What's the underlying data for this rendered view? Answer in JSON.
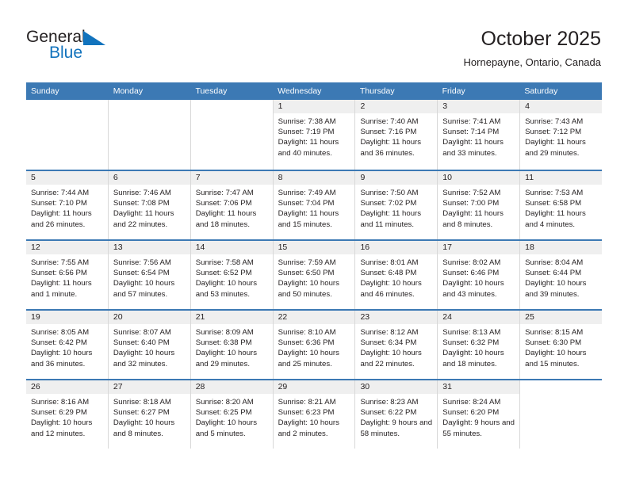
{
  "logo": {
    "word_one": "General",
    "word_two": "Blue",
    "triangle_icon": "triangle-icon",
    "brand_blue": "#1273bd"
  },
  "header": {
    "title": "October 2025",
    "subtitle": "Hornepayne, Ontario, Canada"
  },
  "theme": {
    "header_row_blue": "#3c79b4",
    "daynum_band_gray": "#efefef",
    "text_color": "#231f20"
  },
  "weekdays": [
    "Sunday",
    "Monday",
    "Tuesday",
    "Wednesday",
    "Thursday",
    "Friday",
    "Saturday"
  ],
  "weeks": [
    [
      {
        "day": "",
        "sunrise": "",
        "sunset": "",
        "daylight": ""
      },
      {
        "day": "",
        "sunrise": "",
        "sunset": "",
        "daylight": ""
      },
      {
        "day": "",
        "sunrise": "",
        "sunset": "",
        "daylight": ""
      },
      {
        "day": "1",
        "sunrise": "Sunrise: 7:38 AM",
        "sunset": "Sunset: 7:19 PM",
        "daylight": "Daylight: 11 hours and 40 minutes."
      },
      {
        "day": "2",
        "sunrise": "Sunrise: 7:40 AM",
        "sunset": "Sunset: 7:16 PM",
        "daylight": "Daylight: 11 hours and 36 minutes."
      },
      {
        "day": "3",
        "sunrise": "Sunrise: 7:41 AM",
        "sunset": "Sunset: 7:14 PM",
        "daylight": "Daylight: 11 hours and 33 minutes."
      },
      {
        "day": "4",
        "sunrise": "Sunrise: 7:43 AM",
        "sunset": "Sunset: 7:12 PM",
        "daylight": "Daylight: 11 hours and 29 minutes."
      }
    ],
    [
      {
        "day": "5",
        "sunrise": "Sunrise: 7:44 AM",
        "sunset": "Sunset: 7:10 PM",
        "daylight": "Daylight: 11 hours and 26 minutes."
      },
      {
        "day": "6",
        "sunrise": "Sunrise: 7:46 AM",
        "sunset": "Sunset: 7:08 PM",
        "daylight": "Daylight: 11 hours and 22 minutes."
      },
      {
        "day": "7",
        "sunrise": "Sunrise: 7:47 AM",
        "sunset": "Sunset: 7:06 PM",
        "daylight": "Daylight: 11 hours and 18 minutes."
      },
      {
        "day": "8",
        "sunrise": "Sunrise: 7:49 AM",
        "sunset": "Sunset: 7:04 PM",
        "daylight": "Daylight: 11 hours and 15 minutes."
      },
      {
        "day": "9",
        "sunrise": "Sunrise: 7:50 AM",
        "sunset": "Sunset: 7:02 PM",
        "daylight": "Daylight: 11 hours and 11 minutes."
      },
      {
        "day": "10",
        "sunrise": "Sunrise: 7:52 AM",
        "sunset": "Sunset: 7:00 PM",
        "daylight": "Daylight: 11 hours and 8 minutes."
      },
      {
        "day": "11",
        "sunrise": "Sunrise: 7:53 AM",
        "sunset": "Sunset: 6:58 PM",
        "daylight": "Daylight: 11 hours and 4 minutes."
      }
    ],
    [
      {
        "day": "12",
        "sunrise": "Sunrise: 7:55 AM",
        "sunset": "Sunset: 6:56 PM",
        "daylight": "Daylight: 11 hours and 1 minute."
      },
      {
        "day": "13",
        "sunrise": "Sunrise: 7:56 AM",
        "sunset": "Sunset: 6:54 PM",
        "daylight": "Daylight: 10 hours and 57 minutes."
      },
      {
        "day": "14",
        "sunrise": "Sunrise: 7:58 AM",
        "sunset": "Sunset: 6:52 PM",
        "daylight": "Daylight: 10 hours and 53 minutes."
      },
      {
        "day": "15",
        "sunrise": "Sunrise: 7:59 AM",
        "sunset": "Sunset: 6:50 PM",
        "daylight": "Daylight: 10 hours and 50 minutes."
      },
      {
        "day": "16",
        "sunrise": "Sunrise: 8:01 AM",
        "sunset": "Sunset: 6:48 PM",
        "daylight": "Daylight: 10 hours and 46 minutes."
      },
      {
        "day": "17",
        "sunrise": "Sunrise: 8:02 AM",
        "sunset": "Sunset: 6:46 PM",
        "daylight": "Daylight: 10 hours and 43 minutes."
      },
      {
        "day": "18",
        "sunrise": "Sunrise: 8:04 AM",
        "sunset": "Sunset: 6:44 PM",
        "daylight": "Daylight: 10 hours and 39 minutes."
      }
    ],
    [
      {
        "day": "19",
        "sunrise": "Sunrise: 8:05 AM",
        "sunset": "Sunset: 6:42 PM",
        "daylight": "Daylight: 10 hours and 36 minutes."
      },
      {
        "day": "20",
        "sunrise": "Sunrise: 8:07 AM",
        "sunset": "Sunset: 6:40 PM",
        "daylight": "Daylight: 10 hours and 32 minutes."
      },
      {
        "day": "21",
        "sunrise": "Sunrise: 8:09 AM",
        "sunset": "Sunset: 6:38 PM",
        "daylight": "Daylight: 10 hours and 29 minutes."
      },
      {
        "day": "22",
        "sunrise": "Sunrise: 8:10 AM",
        "sunset": "Sunset: 6:36 PM",
        "daylight": "Daylight: 10 hours and 25 minutes."
      },
      {
        "day": "23",
        "sunrise": "Sunrise: 8:12 AM",
        "sunset": "Sunset: 6:34 PM",
        "daylight": "Daylight: 10 hours and 22 minutes."
      },
      {
        "day": "24",
        "sunrise": "Sunrise: 8:13 AM",
        "sunset": "Sunset: 6:32 PM",
        "daylight": "Daylight: 10 hours and 18 minutes."
      },
      {
        "day": "25",
        "sunrise": "Sunrise: 8:15 AM",
        "sunset": "Sunset: 6:30 PM",
        "daylight": "Daylight: 10 hours and 15 minutes."
      }
    ],
    [
      {
        "day": "26",
        "sunrise": "Sunrise: 8:16 AM",
        "sunset": "Sunset: 6:29 PM",
        "daylight": "Daylight: 10 hours and 12 minutes."
      },
      {
        "day": "27",
        "sunrise": "Sunrise: 8:18 AM",
        "sunset": "Sunset: 6:27 PM",
        "daylight": "Daylight: 10 hours and 8 minutes."
      },
      {
        "day": "28",
        "sunrise": "Sunrise: 8:20 AM",
        "sunset": "Sunset: 6:25 PM",
        "daylight": "Daylight: 10 hours and 5 minutes."
      },
      {
        "day": "29",
        "sunrise": "Sunrise: 8:21 AM",
        "sunset": "Sunset: 6:23 PM",
        "daylight": "Daylight: 10 hours and 2 minutes."
      },
      {
        "day": "30",
        "sunrise": "Sunrise: 8:23 AM",
        "sunset": "Sunset: 6:22 PM",
        "daylight": "Daylight: 9 hours and 58 minutes."
      },
      {
        "day": "31",
        "sunrise": "Sunrise: 8:24 AM",
        "sunset": "Sunset: 6:20 PM",
        "daylight": "Daylight: 9 hours and 55 minutes."
      },
      {
        "day": "",
        "sunrise": "",
        "sunset": "",
        "daylight": ""
      }
    ]
  ]
}
